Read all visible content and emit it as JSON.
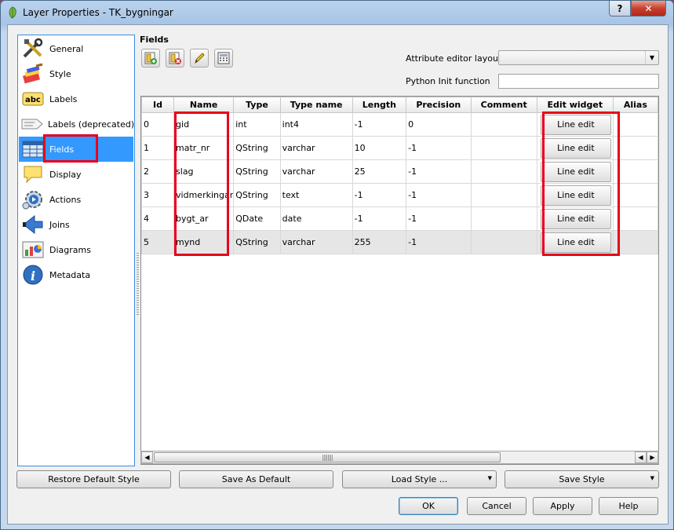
{
  "window": {
    "title": "Layer Properties - TK_bygningar",
    "help_glyph": "?",
    "close_glyph": "✕"
  },
  "sidebar": {
    "items": [
      {
        "label": "General",
        "icon": "general-tools-icon"
      },
      {
        "label": "Style",
        "icon": "style-brush-icon"
      },
      {
        "label": "Labels",
        "icon": "labels-abc-icon"
      },
      {
        "label": "Labels (deprecated)",
        "icon": "labels-deprecated-icon"
      },
      {
        "label": "Fields",
        "icon": "fields-table-icon",
        "selected": true
      },
      {
        "label": "Display",
        "icon": "display-speech-icon"
      },
      {
        "label": "Actions",
        "icon": "actions-gear-icon"
      },
      {
        "label": "Joins",
        "icon": "joins-arrow-icon"
      },
      {
        "label": "Diagrams",
        "icon": "diagrams-chart-icon"
      },
      {
        "label": "Metadata",
        "icon": "metadata-info-icon"
      }
    ]
  },
  "fields": {
    "title": "Fields",
    "toolbar": [
      "new-column-icon",
      "delete-column-icon",
      "toggle-editing-icon",
      "field-calculator-icon"
    ],
    "attribute_editor_layout_label": "Attribute editor layout:",
    "attribute_editor_layout_value": "",
    "python_init_label": "Python Init function",
    "python_init_value": "",
    "columns": [
      "Id",
      "Name",
      "Type",
      "Type name",
      "Length",
      "Precision",
      "Comment",
      "Edit widget",
      "Alias"
    ],
    "rows": [
      {
        "id": "0",
        "name": "gid",
        "type": "int",
        "type_name": "int4",
        "length": "-1",
        "precision": "0",
        "comment": "",
        "widget": "Line edit",
        "alias": ""
      },
      {
        "id": "1",
        "name": "matr_nr",
        "type": "QString",
        "type_name": "varchar",
        "length": "10",
        "precision": "-1",
        "comment": "",
        "widget": "Line edit",
        "alias": ""
      },
      {
        "id": "2",
        "name": "slag",
        "type": "QString",
        "type_name": "varchar",
        "length": "25",
        "precision": "-1",
        "comment": "",
        "widget": "Line edit",
        "alias": ""
      },
      {
        "id": "3",
        "name": "vidmerkingar",
        "type": "QString",
        "type_name": "text",
        "length": "-1",
        "precision": "-1",
        "comment": "",
        "widget": "Line edit",
        "alias": ""
      },
      {
        "id": "4",
        "name": "bygt_ar",
        "type": "QDate",
        "type_name": "date",
        "length": "-1",
        "precision": "-1",
        "comment": "",
        "widget": "Line edit",
        "alias": ""
      },
      {
        "id": "5",
        "name": "mynd",
        "type": "QString",
        "type_name": "varchar",
        "length": "255",
        "precision": "-1",
        "comment": "",
        "widget": "Line edit",
        "alias": ""
      }
    ]
  },
  "style_buttons": {
    "restore_default": "Restore Default Style",
    "save_as_default": "Save As Default",
    "load_style": "Load Style ...",
    "save_style": "Save Style"
  },
  "dialog_buttons": {
    "ok": "OK",
    "cancel": "Cancel",
    "apply": "Apply",
    "help": "Help"
  },
  "colors": {
    "selection": "#3399ff",
    "highlight": "#e8001c"
  }
}
